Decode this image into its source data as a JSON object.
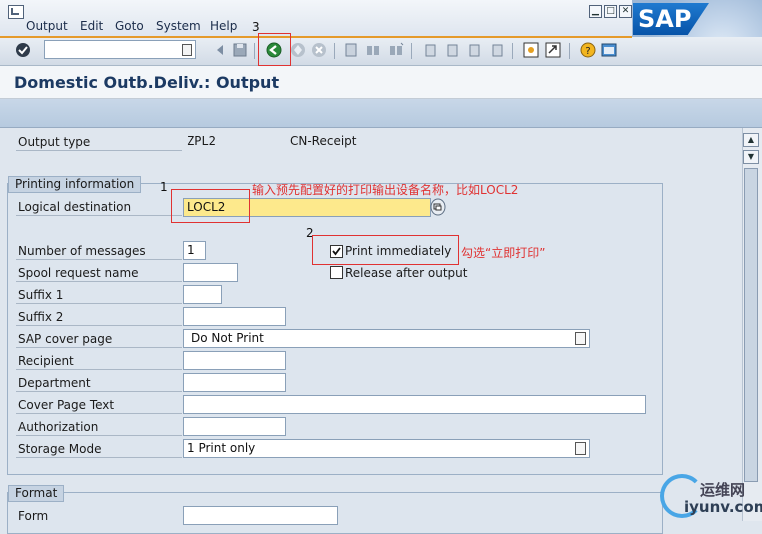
{
  "menu": {
    "output": "Output",
    "edit": "Edit",
    "goto": "Goto",
    "system": "System",
    "help": "Help"
  },
  "window": {
    "minimize": "▢",
    "restore": "□",
    "close": "✕"
  },
  "logo": "SAP",
  "title": "Domestic Outb.Deliv.: Output",
  "form": {
    "output_type_label": "Output type",
    "output_type_value": "ZPL2",
    "output_type_desc": "CN-Receipt",
    "printing_group": "Printing information",
    "logical_destination_label": "Logical destination",
    "logical_destination_value": "LOCL2",
    "number_of_messages_label": "Number of messages",
    "number_of_messages_value": "1",
    "spool_request_label": "Spool request name",
    "suffix1_label": "Suffix 1",
    "suffix2_label": "Suffix 2",
    "sap_cover_page_label": "SAP cover page",
    "sap_cover_page_value": "Do Not Print",
    "recipient_label": "Recipient",
    "department_label": "Department",
    "cover_page_text_label": "Cover Page Text",
    "authorization_label": "Authorization",
    "storage_mode_label": "Storage Mode",
    "storage_mode_value": "1 Print only",
    "print_immediately_label": "Print immediately",
    "print_immediately_checked": true,
    "release_after_output_label": "Release after output",
    "format_group": "Format",
    "form_label": "Form"
  },
  "annotations": {
    "step1": "1",
    "step2": "2",
    "step3": "3",
    "note1": "输入预先配置好的打印输出设备名称，比如LOCL2",
    "note2": "勾选“立即打印”"
  },
  "watermark": {
    "line1": "运维网",
    "line2": "iyunv.com"
  },
  "colors": {
    "annotation": "#e03232",
    "accent": "#e59a2b",
    "title": "#1c3a63",
    "highlight": "#fde98c"
  }
}
